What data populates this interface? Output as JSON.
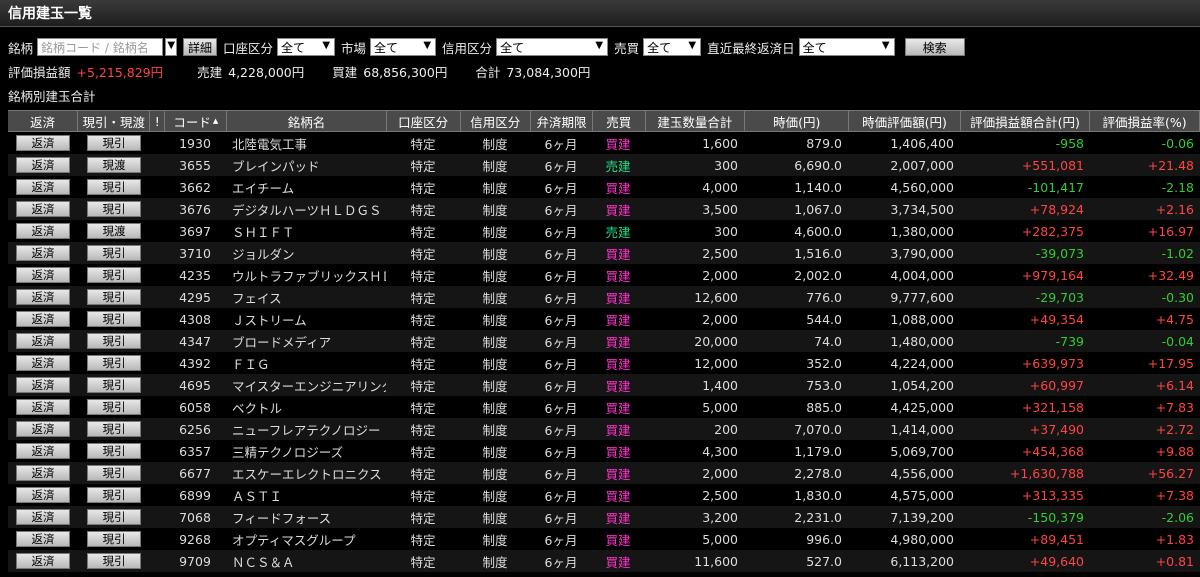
{
  "title": "信用建玉一覧",
  "filters": {
    "brand_label": "銘柄",
    "brand_placeholder": "銘柄コード / 銘柄名",
    "detail_button": "詳細",
    "account_label": "口座区分",
    "account_value": "全て",
    "market_label": "市場",
    "market_value": "全て",
    "credit_label": "信用区分",
    "credit_value": "全て",
    "trade_label": "売買",
    "trade_value": "全て",
    "due_label": "直近最終返済日",
    "due_value": "全て",
    "search_button": "検索"
  },
  "summary": {
    "pl_label": "評価損益額",
    "pl_value": "+5,215,829円",
    "sell_label": "売建",
    "sell_value": "4,228,000円",
    "buy_label": "買建",
    "buy_value": "68,856,300円",
    "total_label": "合計",
    "total_value": "73,084,300円"
  },
  "section_title": "銘柄別建玉合計",
  "columns": [
    "返済",
    "現引・現渡",
    "!",
    "コード",
    "銘柄名",
    "口座区分",
    "信用区分",
    "弁済期限",
    "売買",
    "建玉数量合計",
    "時価(円)",
    "時価評価額(円)",
    "評価損益額合計(円)",
    "評価損益率(%)"
  ],
  "rows": [
    {
      "b1": "返済",
      "b2": "現引",
      "code": "1930",
      "name": "北陸電気工事",
      "acct": "特定",
      "credit": "制度",
      "term": "6ヶ月",
      "side": "買建",
      "qty": "1,600",
      "price": "879.0",
      "value": "1,406,400",
      "pl": "-958",
      "rate": "-0.06"
    },
    {
      "b1": "返済",
      "b2": "現渡",
      "code": "3655",
      "name": "ブレインパッド",
      "acct": "特定",
      "credit": "制度",
      "term": "6ヶ月",
      "side": "売建",
      "qty": "300",
      "price": "6,690.0",
      "value": "2,007,000",
      "pl": "+551,081",
      "rate": "+21.48"
    },
    {
      "b1": "返済",
      "b2": "現引",
      "code": "3662",
      "name": "エイチーム",
      "acct": "特定",
      "credit": "制度",
      "term": "6ヶ月",
      "side": "買建",
      "qty": "4,000",
      "price": "1,140.0",
      "value": "4,560,000",
      "pl": "-101,417",
      "rate": "-2.18"
    },
    {
      "b1": "返済",
      "b2": "現引",
      "code": "3676",
      "name": "デジタルハーツＨＬＤＧＳ",
      "acct": "特定",
      "credit": "制度",
      "term": "6ヶ月",
      "side": "買建",
      "qty": "3,500",
      "price": "1,067.0",
      "value": "3,734,500",
      "pl": "+78,924",
      "rate": "+2.16"
    },
    {
      "b1": "返済",
      "b2": "現渡",
      "code": "3697",
      "name": "ＳＨＩＦＴ",
      "acct": "特定",
      "credit": "制度",
      "term": "6ヶ月",
      "side": "売建",
      "qty": "300",
      "price": "4,600.0",
      "value": "1,380,000",
      "pl": "+282,375",
      "rate": "+16.97"
    },
    {
      "b1": "返済",
      "b2": "現引",
      "code": "3710",
      "name": "ジョルダン",
      "acct": "特定",
      "credit": "制度",
      "term": "6ヶ月",
      "side": "買建",
      "qty": "2,500",
      "price": "1,516.0",
      "value": "3,790,000",
      "pl": "-39,073",
      "rate": "-1.02"
    },
    {
      "b1": "返済",
      "b2": "現引",
      "code": "4235",
      "name": "ウルトラファブリックスＨＤ",
      "acct": "特定",
      "credit": "制度",
      "term": "6ヶ月",
      "side": "買建",
      "qty": "2,000",
      "price": "2,002.0",
      "value": "4,004,000",
      "pl": "+979,164",
      "rate": "+32.49"
    },
    {
      "b1": "返済",
      "b2": "現引",
      "code": "4295",
      "name": "フェイス",
      "acct": "特定",
      "credit": "制度",
      "term": "6ヶ月",
      "side": "買建",
      "qty": "12,600",
      "price": "776.0",
      "value": "9,777,600",
      "pl": "-29,703",
      "rate": "-0.30"
    },
    {
      "b1": "返済",
      "b2": "現引",
      "code": "4308",
      "name": "Ｊストリーム",
      "acct": "特定",
      "credit": "制度",
      "term": "6ヶ月",
      "side": "買建",
      "qty": "2,000",
      "price": "544.0",
      "value": "1,088,000",
      "pl": "+49,354",
      "rate": "+4.75"
    },
    {
      "b1": "返済",
      "b2": "現引",
      "code": "4347",
      "name": "ブロードメディア",
      "acct": "特定",
      "credit": "制度",
      "term": "6ヶ月",
      "side": "買建",
      "qty": "20,000",
      "price": "74.0",
      "value": "1,480,000",
      "pl": "-739",
      "rate": "-0.04"
    },
    {
      "b1": "返済",
      "b2": "現引",
      "code": "4392",
      "name": "ＦＩＧ",
      "acct": "特定",
      "credit": "制度",
      "term": "6ヶ月",
      "side": "買建",
      "qty": "12,000",
      "price": "352.0",
      "value": "4,224,000",
      "pl": "+639,973",
      "rate": "+17.95"
    },
    {
      "b1": "返済",
      "b2": "現引",
      "code": "4695",
      "name": "マイスターエンジニアリング",
      "acct": "特定",
      "credit": "制度",
      "term": "6ヶ月",
      "side": "買建",
      "qty": "1,400",
      "price": "753.0",
      "value": "1,054,200",
      "pl": "+60,997",
      "rate": "+6.14"
    },
    {
      "b1": "返済",
      "b2": "現引",
      "code": "6058",
      "name": "ベクトル",
      "acct": "特定",
      "credit": "制度",
      "term": "6ヶ月",
      "side": "買建",
      "qty": "5,000",
      "price": "885.0",
      "value": "4,425,000",
      "pl": "+321,158",
      "rate": "+7.83"
    },
    {
      "b1": "返済",
      "b2": "現引",
      "code": "6256",
      "name": "ニューフレアテクノロジー",
      "acct": "特定",
      "credit": "制度",
      "term": "6ヶ月",
      "side": "買建",
      "qty": "200",
      "price": "7,070.0",
      "value": "1,414,000",
      "pl": "+37,490",
      "rate": "+2.72"
    },
    {
      "b1": "返済",
      "b2": "現引",
      "code": "6357",
      "name": "三精テクノロジーズ",
      "acct": "特定",
      "credit": "制度",
      "term": "6ヶ月",
      "side": "買建",
      "qty": "4,300",
      "price": "1,179.0",
      "value": "5,069,700",
      "pl": "+454,368",
      "rate": "+9.88"
    },
    {
      "b1": "返済",
      "b2": "現引",
      "code": "6677",
      "name": "エスケーエレクトロニクス",
      "acct": "特定",
      "credit": "制度",
      "term": "6ヶ月",
      "side": "買建",
      "qty": "2,000",
      "price": "2,278.0",
      "value": "4,556,000",
      "pl": "+1,630,788",
      "rate": "+56.27"
    },
    {
      "b1": "返済",
      "b2": "現引",
      "code": "6899",
      "name": "ＡＳＴＩ",
      "acct": "特定",
      "credit": "制度",
      "term": "6ヶ月",
      "side": "買建",
      "qty": "2,500",
      "price": "1,830.0",
      "value": "4,575,000",
      "pl": "+313,335",
      "rate": "+7.38"
    },
    {
      "b1": "返済",
      "b2": "現引",
      "code": "7068",
      "name": "フィードフォース",
      "acct": "特定",
      "credit": "制度",
      "term": "6ヶ月",
      "side": "買建",
      "qty": "3,200",
      "price": "2,231.0",
      "value": "7,139,200",
      "pl": "-150,379",
      "rate": "-2.06"
    },
    {
      "b1": "返済",
      "b2": "現引",
      "code": "9268",
      "name": "オプティマスグループ",
      "acct": "特定",
      "credit": "制度",
      "term": "6ヶ月",
      "side": "買建",
      "qty": "5,000",
      "price": "996.0",
      "value": "4,980,000",
      "pl": "+89,451",
      "rate": "+1.83"
    },
    {
      "b1": "返済",
      "b2": "現引",
      "code": "9709",
      "name": "ＮＣＳ＆Ａ",
      "acct": "特定",
      "credit": "制度",
      "term": "6ヶ月",
      "side": "買建",
      "qty": "11,600",
      "price": "527.0",
      "value": "6,113,200",
      "pl": "+49,640",
      "rate": "+0.81"
    }
  ]
}
